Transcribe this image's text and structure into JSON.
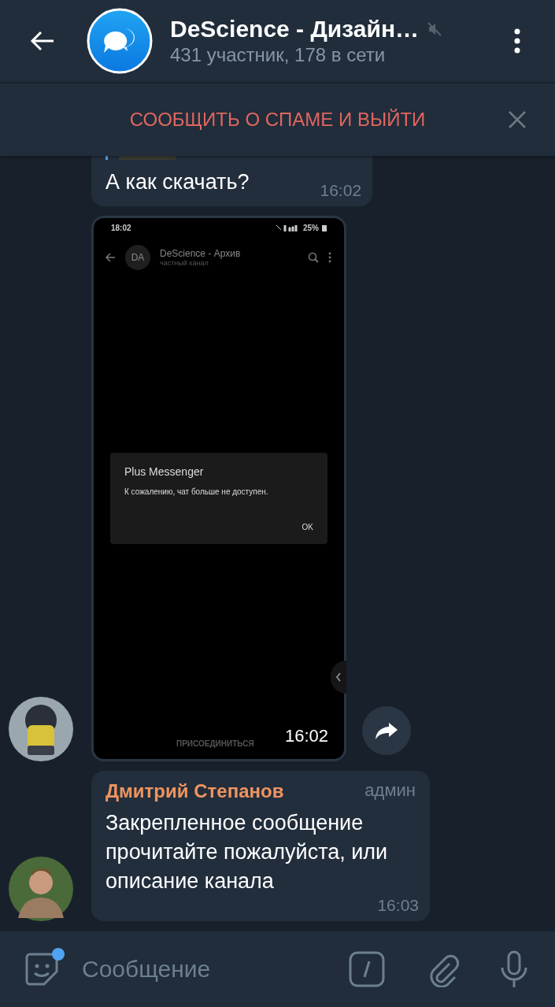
{
  "header": {
    "title": "DeScience - Дизайн…",
    "subtitle": "431 участник, 178 в сети",
    "muted": true
  },
  "banner": {
    "text": "СООБЩИТЬ О СПАМЕ И ВЫЙТИ"
  },
  "messages": [
    {
      "kind": "text",
      "has_reply": true,
      "avatar": false,
      "forward": false,
      "text": "А как скачать?",
      "time": "16:02"
    },
    {
      "kind": "screenshot",
      "avatar": true,
      "forward": true,
      "time": "16:02",
      "shot": {
        "status_time": "18:02",
        "battery": "25%",
        "channel_initials": "DA",
        "channel_name": "DeScience - Архив",
        "channel_type": "частный канал",
        "dialog_title": "Plus Messenger",
        "dialog_message": "К сожалению, чат больше не доступен.",
        "dialog_button": "OK",
        "join": "ПРИСОЕДИНИТЬСЯ"
      }
    },
    {
      "kind": "text",
      "has_reply": false,
      "avatar": true,
      "forward": false,
      "sender": "Дмитрий Степанов",
      "role": "админ",
      "text": "Закрепленное сообщение прочитайте пожалуйста, или описание канала",
      "time": "16:03"
    }
  ],
  "composer": {
    "placeholder": "Сообщение",
    "sticker_badge": true
  }
}
